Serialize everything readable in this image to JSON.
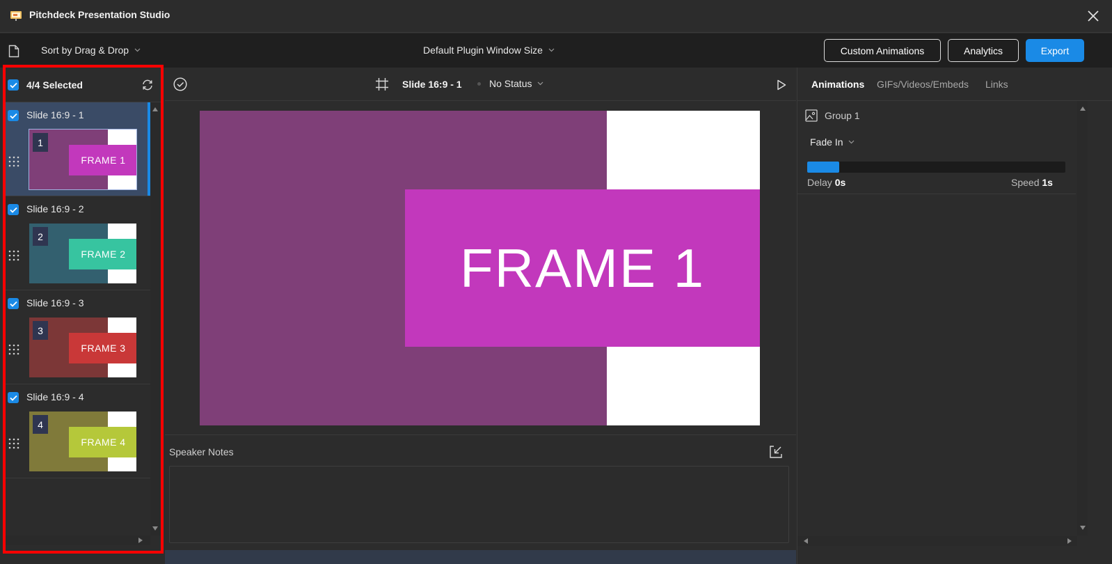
{
  "window": {
    "title": "Pitchdeck Presentation Studio"
  },
  "toolbar": {
    "sort_label": "Sort by Drag & Drop",
    "window_size_label": "Default Plugin Window Size",
    "custom_animations_label": "Custom Animations",
    "analytics_label": "Analytics",
    "export_label": "Export"
  },
  "sidebar": {
    "selected_count": "4/4 Selected",
    "slides": [
      {
        "name": "Slide 16:9 - 1",
        "number": "1",
        "frame_label": "FRAME 1",
        "bg_color": "#7f3f78",
        "frame_color": "#c238bc",
        "selected": true,
        "active": true
      },
      {
        "name": "Slide 16:9 - 2",
        "number": "2",
        "frame_label": "FRAME 2",
        "bg_color": "#33606f",
        "frame_color": "#37c4a0",
        "selected": true,
        "active": false
      },
      {
        "name": "Slide 16:9 - 3",
        "number": "3",
        "frame_label": "FRAME 3",
        "bg_color": "#7c3737",
        "frame_color": "#c93838",
        "selected": true,
        "active": false
      },
      {
        "name": "Slide 16:9 - 4",
        "number": "4",
        "frame_label": "FRAME 4",
        "bg_color": "#807a3a",
        "frame_color": "#b5c83a",
        "selected": true,
        "active": false
      }
    ]
  },
  "editor": {
    "slide_title": "Slide 16:9 - 1",
    "status": "No Status",
    "frame_label": "FRAME 1",
    "bg_color": "#7f3f78",
    "frame_color": "#c238bc",
    "speaker_notes_label": "Speaker Notes",
    "speaker_notes_value": ""
  },
  "right_panel": {
    "tabs": [
      "Animations",
      "GIFs/Videos/Embeds",
      "Links"
    ],
    "active_tab": "Animations",
    "group_name": "Group 1",
    "effect": "Fade In",
    "delay_label": "Delay",
    "delay_value": "0s",
    "speed_label": "Speed",
    "speed_value": "1s",
    "timeline_progress": 0.125
  },
  "colors": {
    "accent": "#1a8ae6",
    "highlight": "#ff0000"
  }
}
